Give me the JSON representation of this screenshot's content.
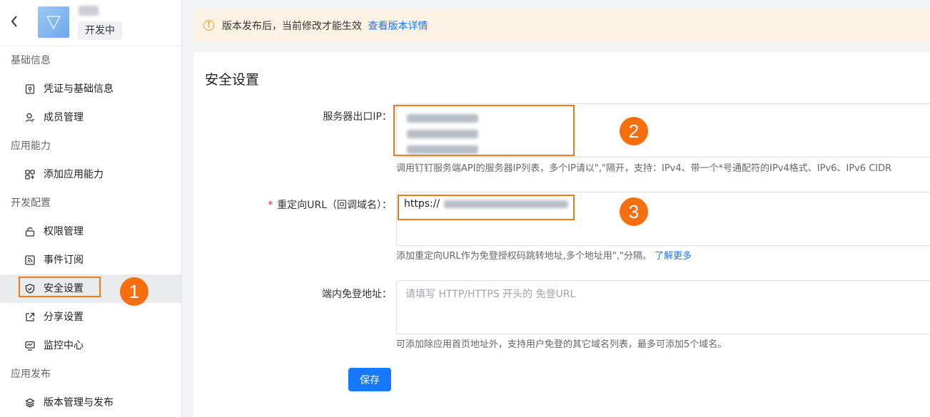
{
  "app": {
    "back_icon": "chevron-left-icon",
    "status_badge": "开发中"
  },
  "sidebar": {
    "sections": [
      {
        "title": "基础信息",
        "items": [
          {
            "label": "凭证与基础信息",
            "icon": "credential-icon"
          },
          {
            "label": "成员管理",
            "icon": "member-icon"
          }
        ]
      },
      {
        "title": "应用能力",
        "items": [
          {
            "label": "添加应用能力",
            "icon": "add-capability-icon"
          }
        ]
      },
      {
        "title": "开发配置",
        "items": [
          {
            "label": "权限管理",
            "icon": "lock-icon"
          },
          {
            "label": "事件订阅",
            "icon": "rss-icon"
          },
          {
            "label": "安全设置",
            "icon": "shield-icon",
            "active": true
          },
          {
            "label": "分享设置",
            "icon": "share-icon"
          },
          {
            "label": "监控中心",
            "icon": "monitor-icon"
          }
        ]
      },
      {
        "title": "应用发布",
        "items": [
          {
            "label": "版本管理与发布",
            "icon": "layers-icon"
          }
        ]
      }
    ]
  },
  "notice": {
    "text": "版本发布后，当前修改才能生效",
    "link": "查看版本详情",
    "accent": "#f0a020"
  },
  "page": {
    "title": "安全设置",
    "fields": {
      "server_ip": {
        "label": "服务器出口IP：",
        "help": "调用钉钉服务端API的服务器IP列表，多个IP请以\",\"隔开，支持：IPv4、带一个*号通配符的IPv4格式、IPv6、IPv6 CIDR"
      },
      "redirect_url": {
        "label": "重定向URL（回调域名）：",
        "required_mark": "*",
        "value_prefix": "https://",
        "help": "添加重定向URL作为免登授权码跳转地址,多个地址用\",\"分隔。",
        "help_link": "了解更多"
      },
      "sso_url": {
        "label": "端内免登地址：",
        "placeholder": "请填写 HTTP/HTTPS 开头的 免登URL",
        "help": "可添加除应用首页地址外，支持用户免登的其它域名列表，最多可添加5个域名。"
      }
    },
    "save_label": "保存"
  },
  "callouts": [
    "1",
    "2",
    "3"
  ],
  "colors": {
    "primary": "#1677ff",
    "highlight": "#f07a19",
    "callout": "#f56f10"
  }
}
